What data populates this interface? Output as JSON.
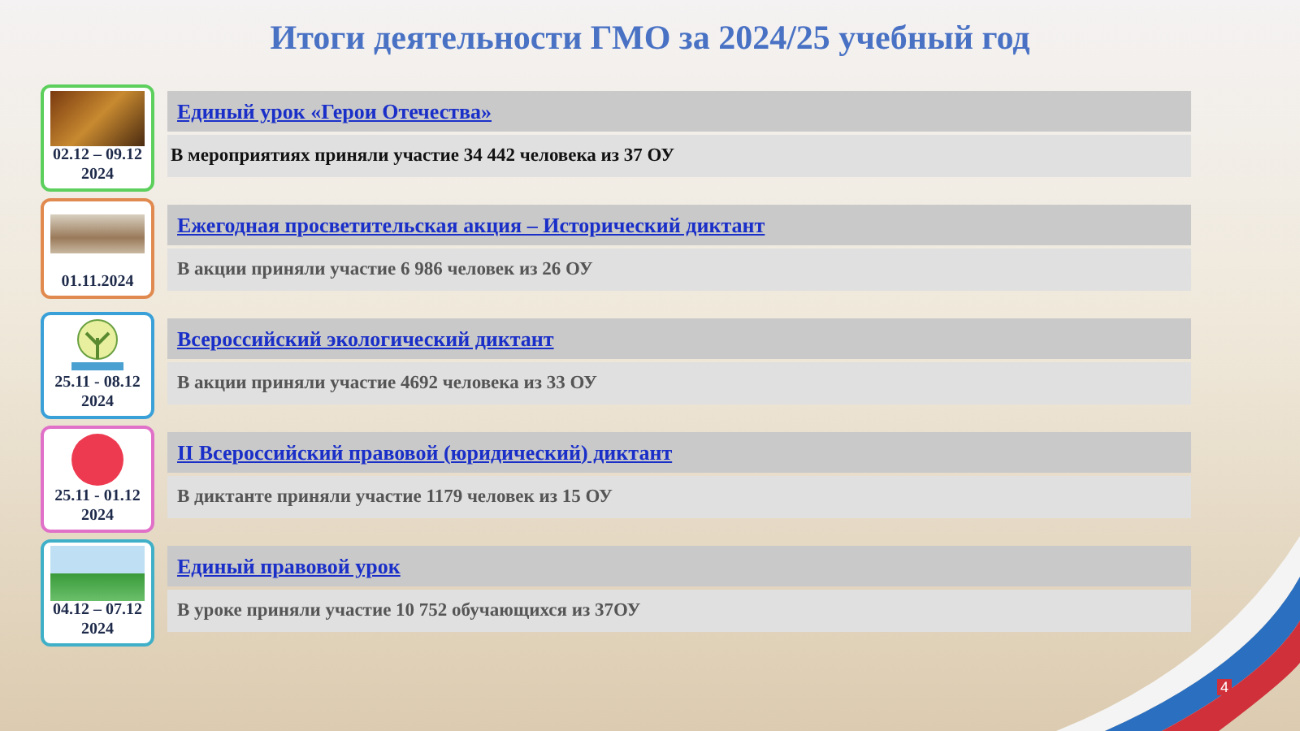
{
  "title": "Итоги деятельности ГМО за 2024/25 учебный год",
  "events": [
    {
      "kind": "photo",
      "color": "#5ccf5c",
      "date": [
        "02.12 – 09.12",
        "2024"
      ],
      "heading": "Единый урок «Герои Отечества»",
      "summary": "В мероприятиях приняли участие 34 442 человека из 37 ОУ"
    },
    {
      "kind": "books",
      "color": "#e08a50",
      "date": [
        "01.11.2024"
      ],
      "heading": "Ежегодная просветительская акция –  Исторический диктант",
      "summary": "В акции приняли участие 6 986 человек из 26 ОУ"
    },
    {
      "kind": "tree",
      "color": "#3aa0d8",
      "date": [
        "25.11 - 08.12",
        "2024"
      ],
      "heading": "Всероссийский экологический диктант",
      "summary": "В акции приняли участие 4692 человека из 33 ОУ"
    },
    {
      "kind": "circle",
      "color": "#e070c8",
      "date": [
        "25.11 - 01.12",
        "2024"
      ],
      "heading": "II Всероссийский правовой (юридический) диктант",
      "summary": "В диктанте приняли участие 1179 человек из 15 ОУ"
    },
    {
      "kind": "banner",
      "color": "#40b0c8",
      "date": [
        "04.12 – 07.12",
        "2024"
      ],
      "heading": "Единый правовой урок",
      "summary": "В уроке приняли участие 10 752 обучающихся из 37ОУ"
    }
  ],
  "page_number": "4"
}
